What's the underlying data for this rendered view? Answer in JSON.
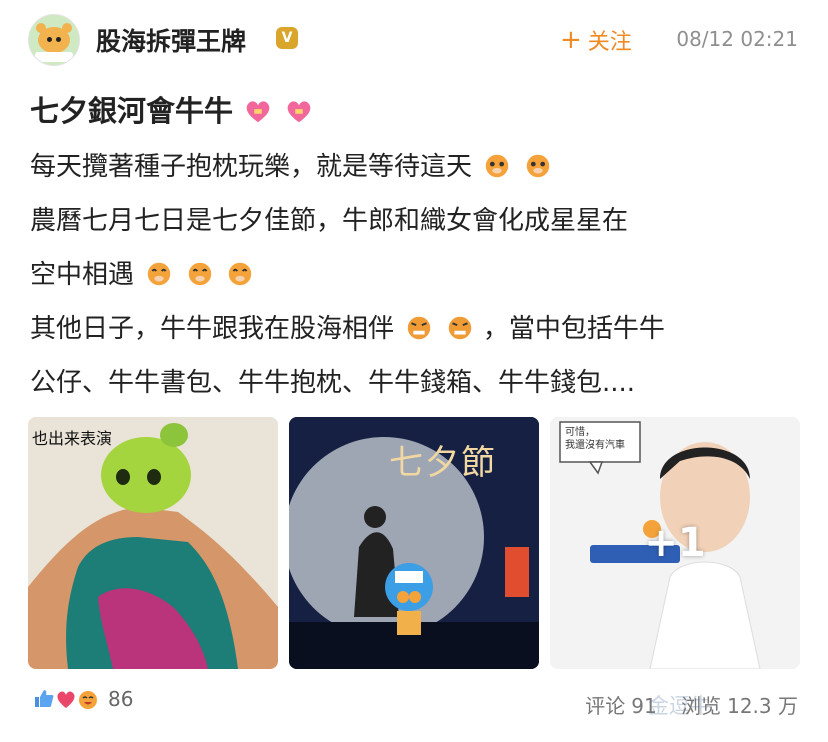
{
  "header": {
    "username": "股海拆彈王牌",
    "verified_badge": "verified-v-badge",
    "follow_label": "关注",
    "follow_color": "#f08a24",
    "time": "08/12 02:21"
  },
  "post": {
    "title": "七夕銀河會牛牛",
    "line1": "每天攬著種子抱枕玩樂，就是等待這天",
    "line2": "農曆七月七日是七夕佳節，牛郎和織女會化成星星在",
    "line3": "空中相遇",
    "line4_a": "其他日子，牛牛跟我在股海相伴",
    "line4_b": "，當中包括牛牛",
    "line5": "公仔、牛牛書包、牛牛抱枕、牛牛錢箱、牛牛錢包...."
  },
  "thumbnails": {
    "caption1": "也出来表演",
    "caption2": "七夕節",
    "caption3": "可惜，\n我還沒有汽車",
    "more_count": "+1"
  },
  "footer": {
    "reactions": [
      "thumbs-up-icon",
      "heart-icon",
      "laugh-bull-icon"
    ],
    "reaction_count": "86",
    "comment_label": "评论",
    "comment_count": "91",
    "view_label": "浏览",
    "view_count": "12.3 万",
    "watermark": "金逗牛"
  }
}
